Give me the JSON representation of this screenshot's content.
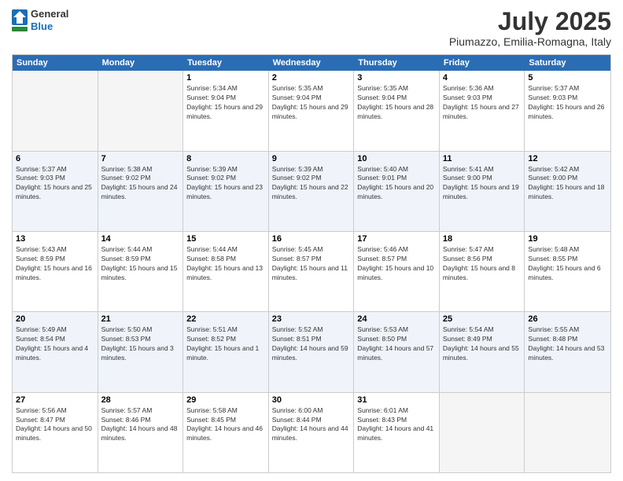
{
  "logo": {
    "general": "General",
    "blue": "Blue"
  },
  "header": {
    "month": "July 2025",
    "location": "Piumazzo, Emilia-Romagna, Italy"
  },
  "weekdays": [
    "Sunday",
    "Monday",
    "Tuesday",
    "Wednesday",
    "Thursday",
    "Friday",
    "Saturday"
  ],
  "rows": [
    [
      {
        "day": "",
        "empty": true
      },
      {
        "day": "",
        "empty": true
      },
      {
        "day": "1",
        "sunrise": "5:34 AM",
        "sunset": "9:04 PM",
        "daylight": "15 hours and 29 minutes."
      },
      {
        "day": "2",
        "sunrise": "5:35 AM",
        "sunset": "9:04 PM",
        "daylight": "15 hours and 29 minutes."
      },
      {
        "day": "3",
        "sunrise": "5:35 AM",
        "sunset": "9:04 PM",
        "daylight": "15 hours and 28 minutes."
      },
      {
        "day": "4",
        "sunrise": "5:36 AM",
        "sunset": "9:03 PM",
        "daylight": "15 hours and 27 minutes."
      },
      {
        "day": "5",
        "sunrise": "5:37 AM",
        "sunset": "9:03 PM",
        "daylight": "15 hours and 26 minutes."
      }
    ],
    [
      {
        "day": "6",
        "sunrise": "5:37 AM",
        "sunset": "9:03 PM",
        "daylight": "15 hours and 25 minutes."
      },
      {
        "day": "7",
        "sunrise": "5:38 AM",
        "sunset": "9:02 PM",
        "daylight": "15 hours and 24 minutes."
      },
      {
        "day": "8",
        "sunrise": "5:39 AM",
        "sunset": "9:02 PM",
        "daylight": "15 hours and 23 minutes."
      },
      {
        "day": "9",
        "sunrise": "5:39 AM",
        "sunset": "9:02 PM",
        "daylight": "15 hours and 22 minutes."
      },
      {
        "day": "10",
        "sunrise": "5:40 AM",
        "sunset": "9:01 PM",
        "daylight": "15 hours and 20 minutes."
      },
      {
        "day": "11",
        "sunrise": "5:41 AM",
        "sunset": "9:00 PM",
        "daylight": "15 hours and 19 minutes."
      },
      {
        "day": "12",
        "sunrise": "5:42 AM",
        "sunset": "9:00 PM",
        "daylight": "15 hours and 18 minutes."
      }
    ],
    [
      {
        "day": "13",
        "sunrise": "5:43 AM",
        "sunset": "8:59 PM",
        "daylight": "15 hours and 16 minutes."
      },
      {
        "day": "14",
        "sunrise": "5:44 AM",
        "sunset": "8:59 PM",
        "daylight": "15 hours and 15 minutes."
      },
      {
        "day": "15",
        "sunrise": "5:44 AM",
        "sunset": "8:58 PM",
        "daylight": "15 hours and 13 minutes."
      },
      {
        "day": "16",
        "sunrise": "5:45 AM",
        "sunset": "8:57 PM",
        "daylight": "15 hours and 11 minutes."
      },
      {
        "day": "17",
        "sunrise": "5:46 AM",
        "sunset": "8:57 PM",
        "daylight": "15 hours and 10 minutes."
      },
      {
        "day": "18",
        "sunrise": "5:47 AM",
        "sunset": "8:56 PM",
        "daylight": "15 hours and 8 minutes."
      },
      {
        "day": "19",
        "sunrise": "5:48 AM",
        "sunset": "8:55 PM",
        "daylight": "15 hours and 6 minutes."
      }
    ],
    [
      {
        "day": "20",
        "sunrise": "5:49 AM",
        "sunset": "8:54 PM",
        "daylight": "15 hours and 4 minutes."
      },
      {
        "day": "21",
        "sunrise": "5:50 AM",
        "sunset": "8:53 PM",
        "daylight": "15 hours and 3 minutes."
      },
      {
        "day": "22",
        "sunrise": "5:51 AM",
        "sunset": "8:52 PM",
        "daylight": "15 hours and 1 minute."
      },
      {
        "day": "23",
        "sunrise": "5:52 AM",
        "sunset": "8:51 PM",
        "daylight": "14 hours and 59 minutes."
      },
      {
        "day": "24",
        "sunrise": "5:53 AM",
        "sunset": "8:50 PM",
        "daylight": "14 hours and 57 minutes."
      },
      {
        "day": "25",
        "sunrise": "5:54 AM",
        "sunset": "8:49 PM",
        "daylight": "14 hours and 55 minutes."
      },
      {
        "day": "26",
        "sunrise": "5:55 AM",
        "sunset": "8:48 PM",
        "daylight": "14 hours and 53 minutes."
      }
    ],
    [
      {
        "day": "27",
        "sunrise": "5:56 AM",
        "sunset": "8:47 PM",
        "daylight": "14 hours and 50 minutes."
      },
      {
        "day": "28",
        "sunrise": "5:57 AM",
        "sunset": "8:46 PM",
        "daylight": "14 hours and 48 minutes."
      },
      {
        "day": "29",
        "sunrise": "5:58 AM",
        "sunset": "8:45 PM",
        "daylight": "14 hours and 46 minutes."
      },
      {
        "day": "30",
        "sunrise": "6:00 AM",
        "sunset": "8:44 PM",
        "daylight": "14 hours and 44 minutes."
      },
      {
        "day": "31",
        "sunrise": "6:01 AM",
        "sunset": "8:43 PM",
        "daylight": "14 hours and 41 minutes."
      },
      {
        "day": "",
        "empty": true
      },
      {
        "day": "",
        "empty": true
      }
    ]
  ]
}
